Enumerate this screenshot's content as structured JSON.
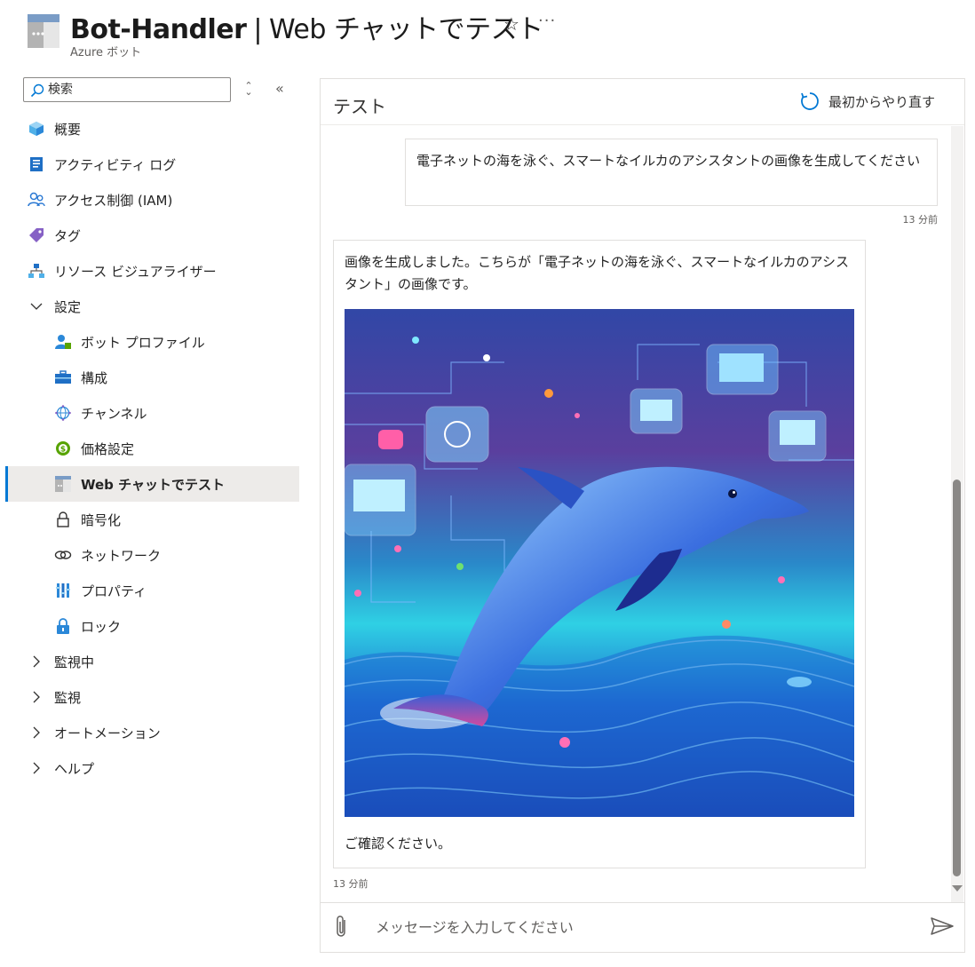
{
  "header": {
    "resource_name": "Bot-Handler",
    "separator": "|",
    "page_name": "Web チャットでテスト",
    "subtitle": "Azure ボット",
    "favorite_icon": "star-icon",
    "more_icon": "ellipsis-icon"
  },
  "sidebar": {
    "search_placeholder": "検索",
    "items": [
      {
        "label": "概要",
        "icon": "cube-icon"
      },
      {
        "label": "アクティビティ ログ",
        "icon": "activity-log-icon"
      },
      {
        "label": "アクセス制御 (IAM)",
        "icon": "people-icon"
      },
      {
        "label": "タグ",
        "icon": "tag-icon"
      },
      {
        "label": "リソース ビジュアライザー",
        "icon": "hierarchy-icon"
      },
      {
        "label": "設定",
        "icon": "chevron-down-icon"
      },
      {
        "label": "ボット プロファイル",
        "icon": "bot-profile-icon"
      },
      {
        "label": "構成",
        "icon": "toolbox-icon"
      },
      {
        "label": "チャンネル",
        "icon": "globe-icon"
      },
      {
        "label": "価格設定",
        "icon": "pricing-icon"
      },
      {
        "label": "Web チャットでテスト",
        "icon": "web-chat-icon"
      },
      {
        "label": "暗号化",
        "icon": "lock-outline-icon"
      },
      {
        "label": "ネットワーク",
        "icon": "link-icon"
      },
      {
        "label": "プロパティ",
        "icon": "properties-icon"
      },
      {
        "label": "ロック",
        "icon": "lock-icon"
      },
      {
        "label": "監視中",
        "icon": "chevron-right-icon"
      },
      {
        "label": "監視",
        "icon": "chevron-right-icon"
      },
      {
        "label": "オートメーション",
        "icon": "chevron-right-icon"
      },
      {
        "label": "ヘルプ",
        "icon": "chevron-right-icon"
      }
    ],
    "selected": "Web チャットでテスト"
  },
  "panel": {
    "title": "テスト",
    "restart_label": "最初からやり直す",
    "user_message": "電子ネットの海を泳ぐ、スマートなイルカのアシスタントの画像を生成してください",
    "user_timestamp": "13 分前",
    "bot_message": "画像を生成しました。こちらが「電子ネットの海を泳ぐ、スマートなイルカのアシスタント」の画像です。",
    "bot_outro": "ご確認ください。",
    "bot_timestamp": "13 分前",
    "input_placeholder": "メッセージを入力してください"
  },
  "colors": {
    "accent": "#0078d4",
    "selected_bg": "#edebe9",
    "border": "#e1dfdd"
  }
}
